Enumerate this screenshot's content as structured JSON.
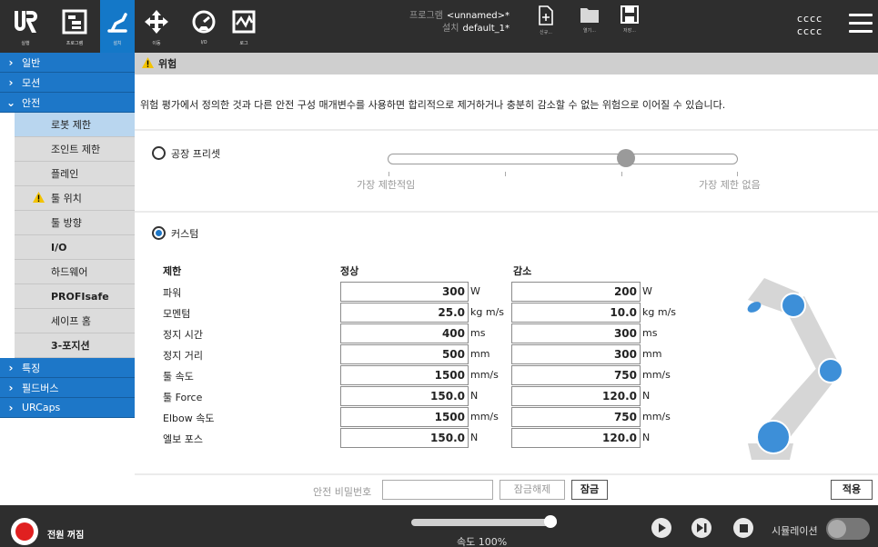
{
  "topbar": {
    "tabs": [
      {
        "label": "실행",
        "icon": "ur-logo-icon"
      },
      {
        "label": "프로그램",
        "icon": "program-icon"
      },
      {
        "label": "설치",
        "icon": "install-robot-icon"
      },
      {
        "label": "이동",
        "icon": "move-arrows-icon"
      },
      {
        "label": "I/O",
        "icon": "io-gauge-icon"
      },
      {
        "label": "로그",
        "icon": "log-chart-icon"
      }
    ],
    "program_key": "프로그램",
    "program_value": "<unnamed>*",
    "install_key": "설치",
    "install_value": "default_1*",
    "file_buttons": [
      {
        "label": "신규...",
        "icon": "new-file-icon"
      },
      {
        "label": "열기...",
        "icon": "open-folder-icon"
      },
      {
        "label": "저장...",
        "icon": "save-icon"
      }
    ],
    "user_line1": "cccc",
    "user_line2": "cccc"
  },
  "nav": {
    "general": "일반",
    "motion": "모션",
    "safety": "안전",
    "safety_items": [
      "로봇 제한",
      "조인트 제한",
      "플레인",
      "툴 위치",
      "툴 방향",
      "I/O",
      "하드웨어",
      "PROFIsafe",
      "세이프 홈",
      "3-포지션"
    ],
    "features": "특징",
    "fieldbus": "필드버스",
    "urcaps": "URCaps"
  },
  "main": {
    "warning_title": "위험",
    "warning_text": "위험 평가에서 정의한 것과 다른 안전 구성 매개변수를 사용하면 합리적으로 제거하거나 충분히 감소할 수 없는 위험으로 이어질 수 있습니다.",
    "preset_label": "공장 프리셋",
    "slider_left": "가장 제한적임",
    "slider_right": "가장 제한 없음",
    "slider_position": 0.68,
    "custom_label": "커스텀",
    "col_limit": "제한",
    "col_normal": "정상",
    "col_reduced": "감소",
    "rows": [
      {
        "label": "파워",
        "normal": "300",
        "normal_unit": "W",
        "reduced": "200",
        "reduced_unit": "W"
      },
      {
        "label": "모멘텀",
        "normal": "25.0",
        "normal_unit": "kg m/s",
        "reduced": "10.0",
        "reduced_unit": "kg m/s"
      },
      {
        "label": "정지 시간",
        "normal": "400",
        "normal_unit": "ms",
        "reduced": "300",
        "reduced_unit": "ms"
      },
      {
        "label": "정지 거리",
        "normal": "500",
        "normal_unit": "mm",
        "reduced": "300",
        "reduced_unit": "mm"
      },
      {
        "label": "툴 속도",
        "normal": "1500",
        "normal_unit": "mm/s",
        "reduced": "750",
        "reduced_unit": "mm/s"
      },
      {
        "label": "툴 Force",
        "normal": "150.0",
        "normal_unit": "N",
        "reduced": "120.0",
        "reduced_unit": "N"
      },
      {
        "label": "Elbow 속도",
        "normal": "1500",
        "normal_unit": "mm/s",
        "reduced": "750",
        "reduced_unit": "mm/s"
      },
      {
        "label": "엘보 포스",
        "normal": "150.0",
        "normal_unit": "N",
        "reduced": "120.0",
        "reduced_unit": "N"
      }
    ],
    "password_label": "안전 비밀번호",
    "password_value": "",
    "unlock_label": "잠금해제",
    "lock_label": "잠금",
    "apply_label": "적용"
  },
  "footer": {
    "power_label": "전원 꺼짐",
    "speed_label": "속도 100%",
    "speed_value": 1.0,
    "simulation_label": "시뮬레이션"
  },
  "colors": {
    "accent": "#1d77c8",
    "warning": "#f3c300",
    "power_off": "#e02020"
  }
}
